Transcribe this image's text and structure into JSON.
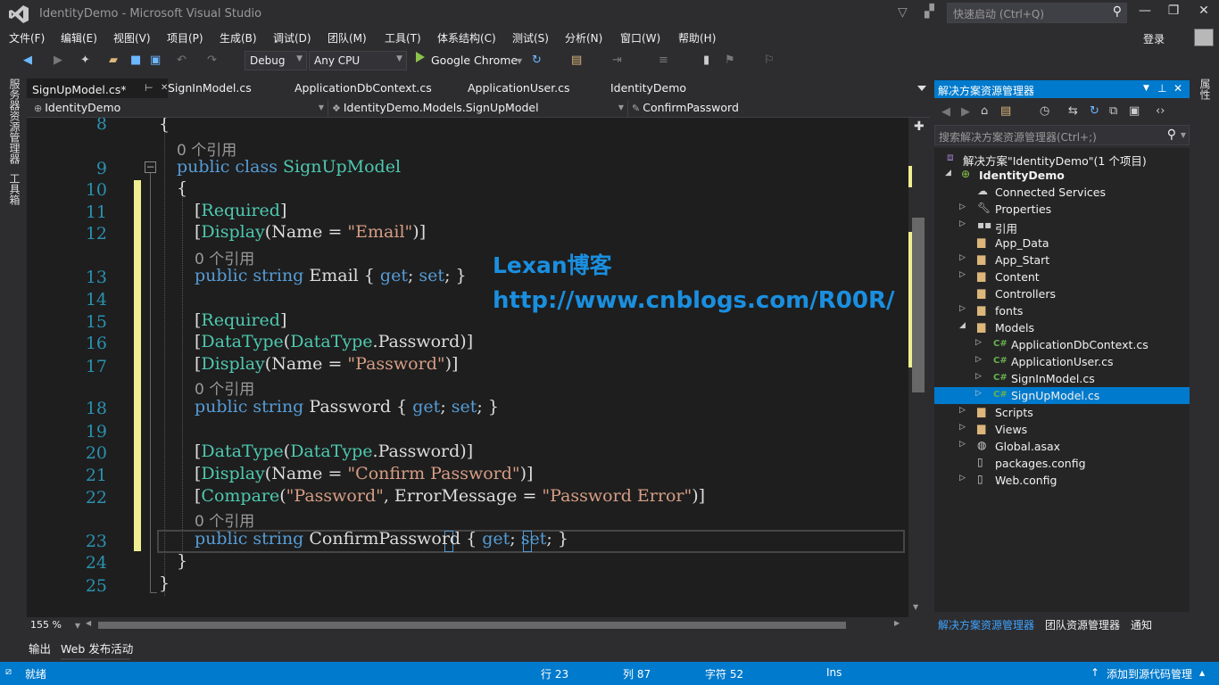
{
  "window": {
    "title": "IdentityDemo - Microsoft Visual Studio",
    "quick_launch_placeholder": "快速启动 (Ctrl+Q)",
    "login": "登录"
  },
  "menu": [
    "文件(F)",
    "编辑(E)",
    "视图(V)",
    "项目(P)",
    "生成(B)",
    "调试(D)",
    "团队(M)",
    "工具(T)",
    "体系结构(C)",
    "测试(S)",
    "分析(N)",
    "窗口(W)",
    "帮助(H)"
  ],
  "toolbar": {
    "config": "Debug",
    "platform": "Any CPU",
    "browser": "Google Chrome"
  },
  "left_strip": [
    "服务器资源管理器",
    "工具箱"
  ],
  "right_strip": [
    "属性"
  ],
  "tabs": [
    {
      "label": "SignUpModel.cs*"
    },
    {
      "label": "SignInModel.cs"
    },
    {
      "label": "ApplicationDbContext.cs"
    },
    {
      "label": "ApplicationUser.cs"
    },
    {
      "label": "IdentityDemo"
    }
  ],
  "navbar": {
    "project": "IdentityDemo",
    "class": "IdentityDemo.Models.SignUpModel",
    "member": "ConfirmPassword"
  },
  "editor": {
    "lines": {
      "n8": "8",
      "n9": "9",
      "n10": "10",
      "n11": "11",
      "n12": "12",
      "n13": "13",
      "n14": "14",
      "n15": "15",
      "n16": "16",
      "n17": "17",
      "n18": "18",
      "n19": "19",
      "n20": "20",
      "n21": "21",
      "n22": "22",
      "n23": "23",
      "n24": "24",
      "n25": "25"
    },
    "codelens": "0 个引用",
    "zoom": "155 %"
  },
  "watermark": {
    "title": "Lexan博客",
    "url": "http://www.cnblogs.com/R00R/"
  },
  "bottom_tabs": [
    "输出",
    "Web 发布活动"
  ],
  "solution_explorer": {
    "title": "解决方案资源管理器",
    "search_placeholder": "搜索解决方案资源管理器(Ctrl+;)",
    "solution": "解决方案\"IdentityDemo\"(1 个项目)",
    "project": "IdentityDemo",
    "items": [
      "Connected Services",
      "Properties",
      "引用",
      "App_Data",
      "App_Start",
      "Content",
      "Controllers",
      "fonts",
      "Models",
      "ApplicationDbContext.cs",
      "ApplicationUser.cs",
      "SignInModel.cs",
      "SignUpModel.cs",
      "Scripts",
      "Views",
      "Global.asax",
      "packages.config",
      "Web.config"
    ],
    "bottom_tabs": [
      "解决方案资源管理器",
      "团队资源管理器",
      "通知"
    ]
  },
  "statusbar": {
    "ready": "就绪",
    "line": "行 23",
    "col": "列 87",
    "char": "字符 52",
    "mode": "Ins",
    "source_control": "添加到源代码管理"
  },
  "colors": {
    "accent": "#007acc",
    "keyword": "#569cd6",
    "type": "#4ec9b0",
    "string": "#d69d85",
    "line_number": "#2b91af",
    "watermark": "#1a8fe0"
  }
}
